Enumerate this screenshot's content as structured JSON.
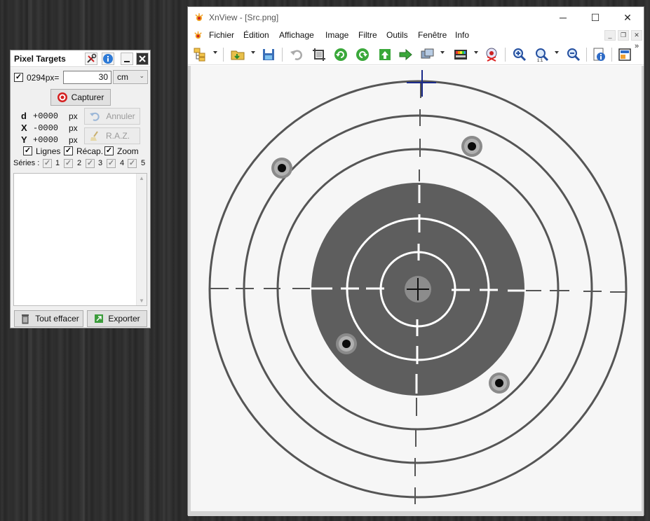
{
  "pixel_targets": {
    "title": "Pixel Targets",
    "scale": {
      "checked": true,
      "label": "0294px=",
      "value": "30",
      "unit": "cm"
    },
    "capture_label": "Capturer",
    "readouts": {
      "d": {
        "label": "d",
        "value": "+0000",
        "unit": "px"
      },
      "x": {
        "label": "X",
        "value": "-0000",
        "unit": "px"
      },
      "y": {
        "label": "Y",
        "value": "+0000",
        "unit": "px"
      }
    },
    "undo_label": "Annuler",
    "reset_label": "R.A.Z.",
    "options": [
      {
        "label": "Lignes",
        "checked": true
      },
      {
        "label": "Récap.",
        "checked": true
      },
      {
        "label": "Zoom",
        "checked": true
      }
    ],
    "series_label": "Séries :",
    "series": [
      "1",
      "2",
      "3",
      "4",
      "5"
    ],
    "clear_all_label": "Tout effacer",
    "export_label": "Exporter",
    "icons": [
      "tools-icon",
      "info-icon",
      "minimize-icon",
      "close-icon",
      "target-icon",
      "undo-icon",
      "broom-icon",
      "trash-icon",
      "export-icon"
    ]
  },
  "xnview": {
    "title": "XnView - [Src.png]",
    "menu": [
      "Fichier",
      "Édition",
      "Affichage",
      "Image",
      "Filtre",
      "Outils",
      "Fenêtre",
      "Info"
    ],
    "toolbar_icons": [
      "browser-icon",
      "open-folder-icon",
      "save-icon",
      "undo-icon",
      "crop-icon",
      "rotate-left-icon",
      "rotate-right-icon",
      "previous-icon",
      "next-icon",
      "slideshow-icon",
      "adjust-colors-icon",
      "red-eye-icon",
      "zoom-in-icon",
      "zoom-1to1-icon",
      "zoom-out-icon",
      "properties-icon",
      "fullscreen-icon"
    ],
    "overflow_label": "»"
  },
  "colors": {
    "accent_blue": "#2e6bc6",
    "target_black_ring": "#555555",
    "target_line": "#444444",
    "crosshair": "#1a2a8a",
    "capture_red": "#d42020"
  }
}
